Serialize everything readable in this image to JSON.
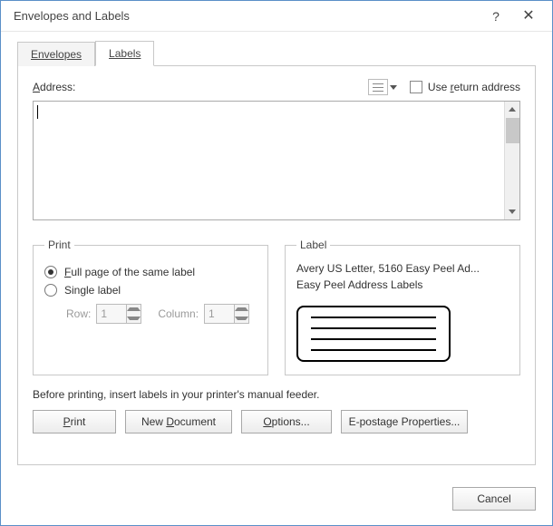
{
  "title": "Envelopes and Labels",
  "tabs": {
    "envelopes": "Envelopes",
    "labels": "Labels",
    "active": "labels"
  },
  "address": {
    "label_pre": "A",
    "label_post": "ddress:",
    "use_return_pre": "Use ",
    "use_return_u": "r",
    "use_return_post": "eturn address",
    "use_return_checked": false,
    "value": ""
  },
  "print": {
    "legend": "Print",
    "full_u": "F",
    "full_post": "ull page of the same label",
    "single": "Single label",
    "selection": "full",
    "row_label": "Row:",
    "row_value": "1",
    "col_label": "Column:",
    "col_value": "1"
  },
  "label": {
    "legend": "Label",
    "line1": "Avery US Letter, 5160 Easy Peel Ad...",
    "line2": "Easy Peel Address Labels"
  },
  "hint": "Before printing, insert labels in your printer's manual feeder.",
  "buttons": {
    "print_u": "P",
    "print_post": "rint",
    "newdoc_pre": "New ",
    "newdoc_u": "D",
    "newdoc_post": "ocument",
    "options_u": "O",
    "options_post": "ptions...",
    "epostage": "E-postage Properties...",
    "cancel": "Cancel"
  }
}
